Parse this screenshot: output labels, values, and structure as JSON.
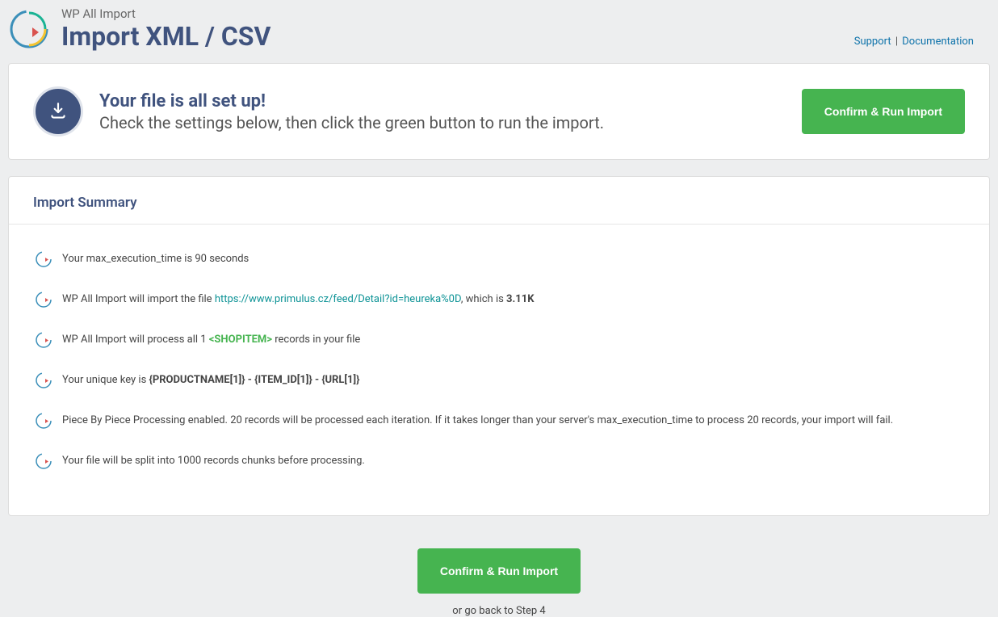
{
  "header": {
    "plugin_label": "WP All Import",
    "page_title": "Import XML / CSV",
    "links": {
      "support": "Support",
      "documentation": "Documentation"
    }
  },
  "setup": {
    "title": "Your file is all set up!",
    "subtitle": "Check the settings below, then click the green button to run the import.",
    "confirm_button": "Confirm & Run Import"
  },
  "summary": {
    "heading": "Import Summary",
    "items": {
      "exec": {
        "text": "Your max_execution_time is 90 seconds"
      },
      "file": {
        "pre": "WP All Import will import the file ",
        "url": "https://www.primulus.cz/feed/Detail?id=heureka%0D",
        "mid": ", which is ",
        "size": "3.11K"
      },
      "process": {
        "pre": "WP All Import will process all 1 ",
        "tag": "<SHOPITEM>",
        "post": " records in your file"
      },
      "key": {
        "pre": "Your unique key is ",
        "value": "{PRODUCTNAME[1]} - {ITEM_ID[1]} - {URL[1]}"
      },
      "piece": {
        "text": "Piece By Piece Processing enabled. 20 records will be processed each iteration. If it takes longer than your server's max_execution_time to process 20 records, your import will fail."
      },
      "chunks": {
        "text": "Your file will be split into 1000 records chunks before processing."
      }
    }
  },
  "footer": {
    "confirm_button": "Confirm & Run Import",
    "back_prefix": "or ",
    "back_link": "go back to Step 4"
  }
}
